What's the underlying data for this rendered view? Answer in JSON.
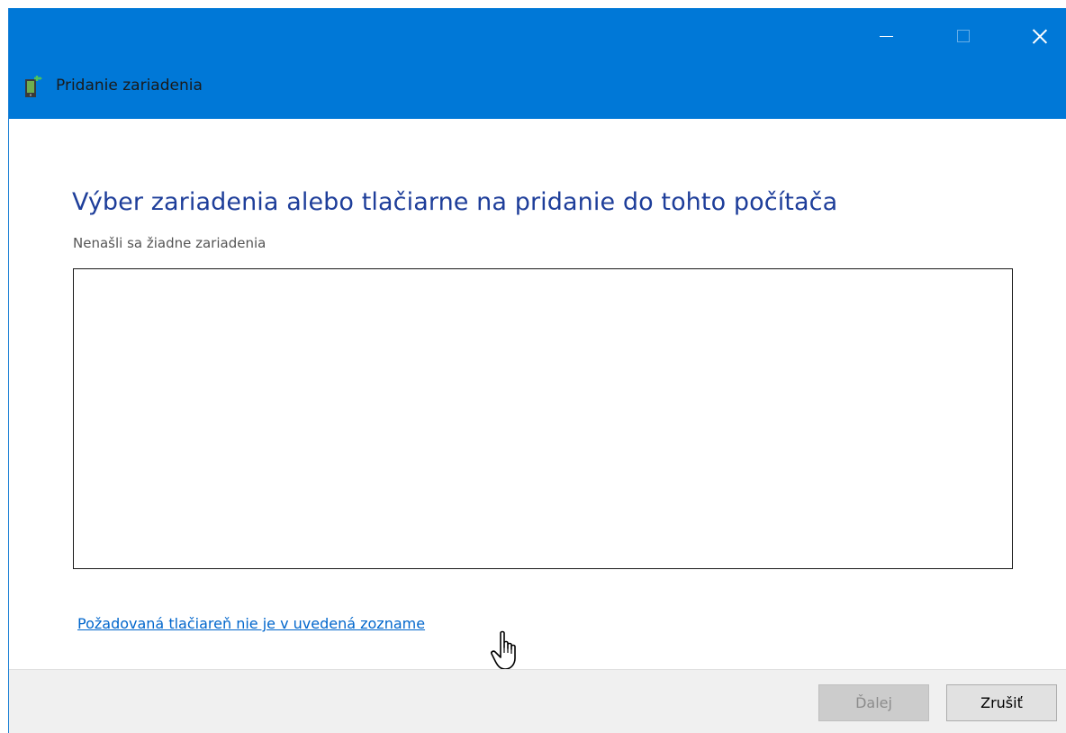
{
  "window": {
    "title": "Pridanie zariadenia"
  },
  "caption_buttons": {
    "minimize_icon": "minimize-icon",
    "maximize_icon": "maximize-icon",
    "close_icon": "close-icon"
  },
  "content": {
    "heading": "Výber zariadenia alebo tlačiarne na pridanie do tohto počítača",
    "status": "Nenašli sa žiadne zariadenia",
    "device_list": [],
    "printer_link": "Požadovaná tlačiareň nie je v uvedená zoznamе"
  },
  "footer": {
    "next_label": "Ďalej",
    "cancel_label": "Zrušiť"
  },
  "colors": {
    "titlebar": "#0078d7",
    "heading": "#1e3e9a",
    "link": "#0066cc"
  }
}
